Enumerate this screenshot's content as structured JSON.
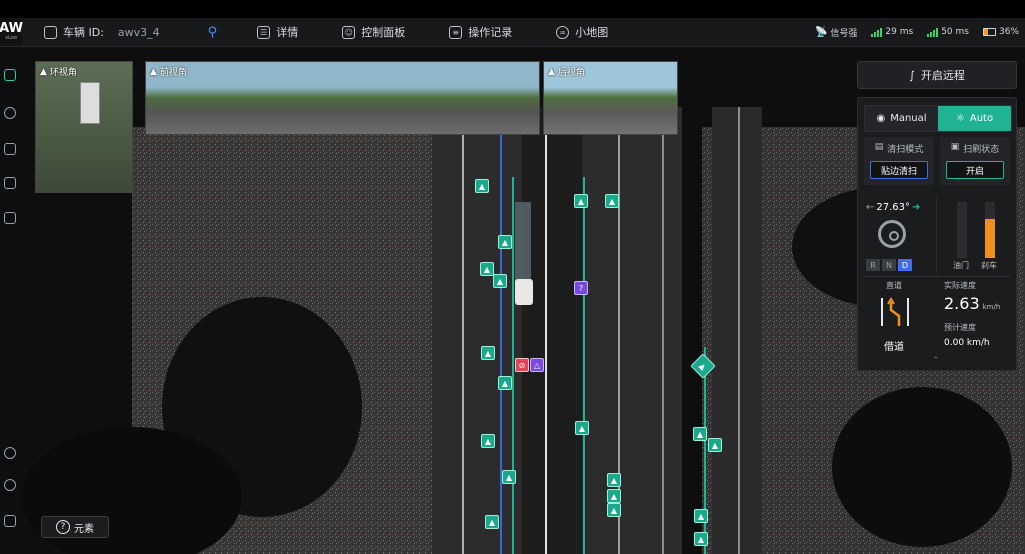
{
  "header": {
    "logo_text": "AW",
    "logo_sub": "vLoo",
    "vehicle_label": "车辆 ID:",
    "vehicle_id": "awv3_4",
    "menu": [
      {
        "label": "详情",
        "icon": "layers-icon"
      },
      {
        "label": "控制面板",
        "icon": "control-panel-icon"
      },
      {
        "label": "操作记录",
        "icon": "log-icon"
      },
      {
        "label": "小地图",
        "icon": "minimap-icon"
      }
    ],
    "status": {
      "signal": "信号强",
      "latency1": "29 ms",
      "latency2": "50 ms",
      "battery": "36%"
    }
  },
  "cameras": [
    {
      "label": "环视角"
    },
    {
      "label": "前视角"
    },
    {
      "label": "后视角"
    }
  ],
  "map": {
    "unknown_marker": "?"
  },
  "remote": {
    "label": "开启远程"
  },
  "control": {
    "mode_manual": "Manual",
    "mode_auto": "Auto",
    "clean_mode_title": "清扫模式",
    "clean_mode_value": "贴边清扫",
    "brush_title": "扫刷状态",
    "brush_value": "开启",
    "steering_angle": "27.63°",
    "gears": [
      "R",
      "N",
      "D"
    ],
    "active_gear": "D",
    "throttle_label": "油门",
    "brake_label": "刹车",
    "throttle_level": 0.0,
    "brake_level": 0.7,
    "lane_title": "直道",
    "lane_action": "借道",
    "actual_speed_label": "实际速度",
    "actual_speed": "2.63",
    "speed_unit": "km/h",
    "planned_speed_label": "预计速度",
    "planned_speed": "0.00 km/h"
  },
  "elements_button": {
    "label": "元素"
  },
  "colors": {
    "accent": "#1fb394",
    "blue": "#3f6ee8",
    "brake": "#f0901c"
  }
}
